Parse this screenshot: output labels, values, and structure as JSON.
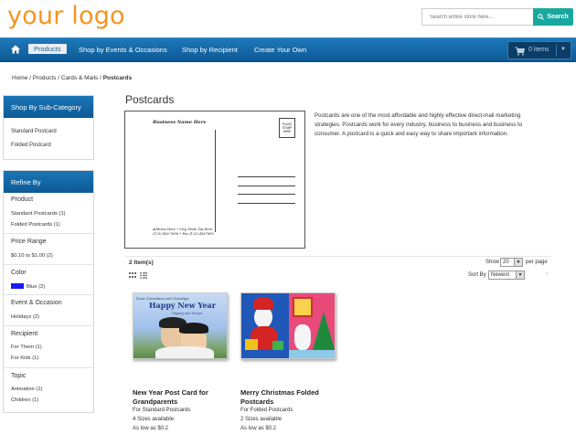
{
  "header": {
    "logo": "your logo",
    "search_placeholder": "Search entire store here...",
    "search_button": "Search"
  },
  "nav": {
    "items": [
      "Products",
      "Shop by Events & Occasions",
      "Shop by Recipient",
      "Create Your Own"
    ],
    "cart_label": "0 items"
  },
  "breadcrumb": {
    "trail": "Home / Products / Cards & Mails / ",
    "current": "Postcards"
  },
  "sidebar": {
    "subcategory_title": "Shop By Sub-Category",
    "subcategories": [
      "Standard Postcard",
      "Folded Postcard"
    ],
    "refine_title": "Refine By",
    "filters": [
      {
        "heading": "Product",
        "options": [
          "Standard Postcards (1)",
          "Folded Postcards (1)"
        ]
      },
      {
        "heading": "Price Range",
        "options": [
          "$0.10 to $1.00 (2)"
        ]
      },
      {
        "heading": "Color",
        "options": [
          "Blue (2)"
        ]
      },
      {
        "heading": "Event & Occasion",
        "options": [
          "Holidays (2)"
        ]
      },
      {
        "heading": "Recipient",
        "options": [
          "For Them (1)",
          "For Kids (1)"
        ]
      },
      {
        "heading": "Topic",
        "options": [
          "Animation (1)",
          "Children (1)"
        ]
      }
    ],
    "color_swatch": "#1a1af5"
  },
  "main": {
    "title": "Postcards",
    "postcard_preview": {
      "business_name": "Business Name Here",
      "stamp_text": [
        "PLACE",
        "STAMP",
        "HERE"
      ],
      "address_lines": [
        "Address Here • City, State Zip Here",
        "(123) 456-7890 • Fax (123) 4567893"
      ]
    },
    "description": "Postcards are one of the most affordable and highly effective direct-mail marketing strategies. Postcards work for every industry, business to business and business to consumer. A postcard is a quick and easy way to share important information.",
    "items_count": "2 Item(s)",
    "show_label": "Show",
    "show_value": "20",
    "per_page": "per page",
    "sort_label": "Sort By",
    "sort_value": "Newest"
  },
  "products": [
    {
      "name": "New Year Post Card for Grandparents",
      "type": "For Standard Postcards",
      "sizes": "4 Sizes available",
      "price": "As low as $0.2",
      "card_text": [
        "Dear Grandma and Grandpa",
        "Happy New Year",
        "Hoping and Sonya"
      ]
    },
    {
      "name": "Merry Christmas Folded Postcards",
      "type": "For Folded Postcards",
      "sizes": "2 Sizes available",
      "price": "As low as $0.2"
    }
  ]
}
